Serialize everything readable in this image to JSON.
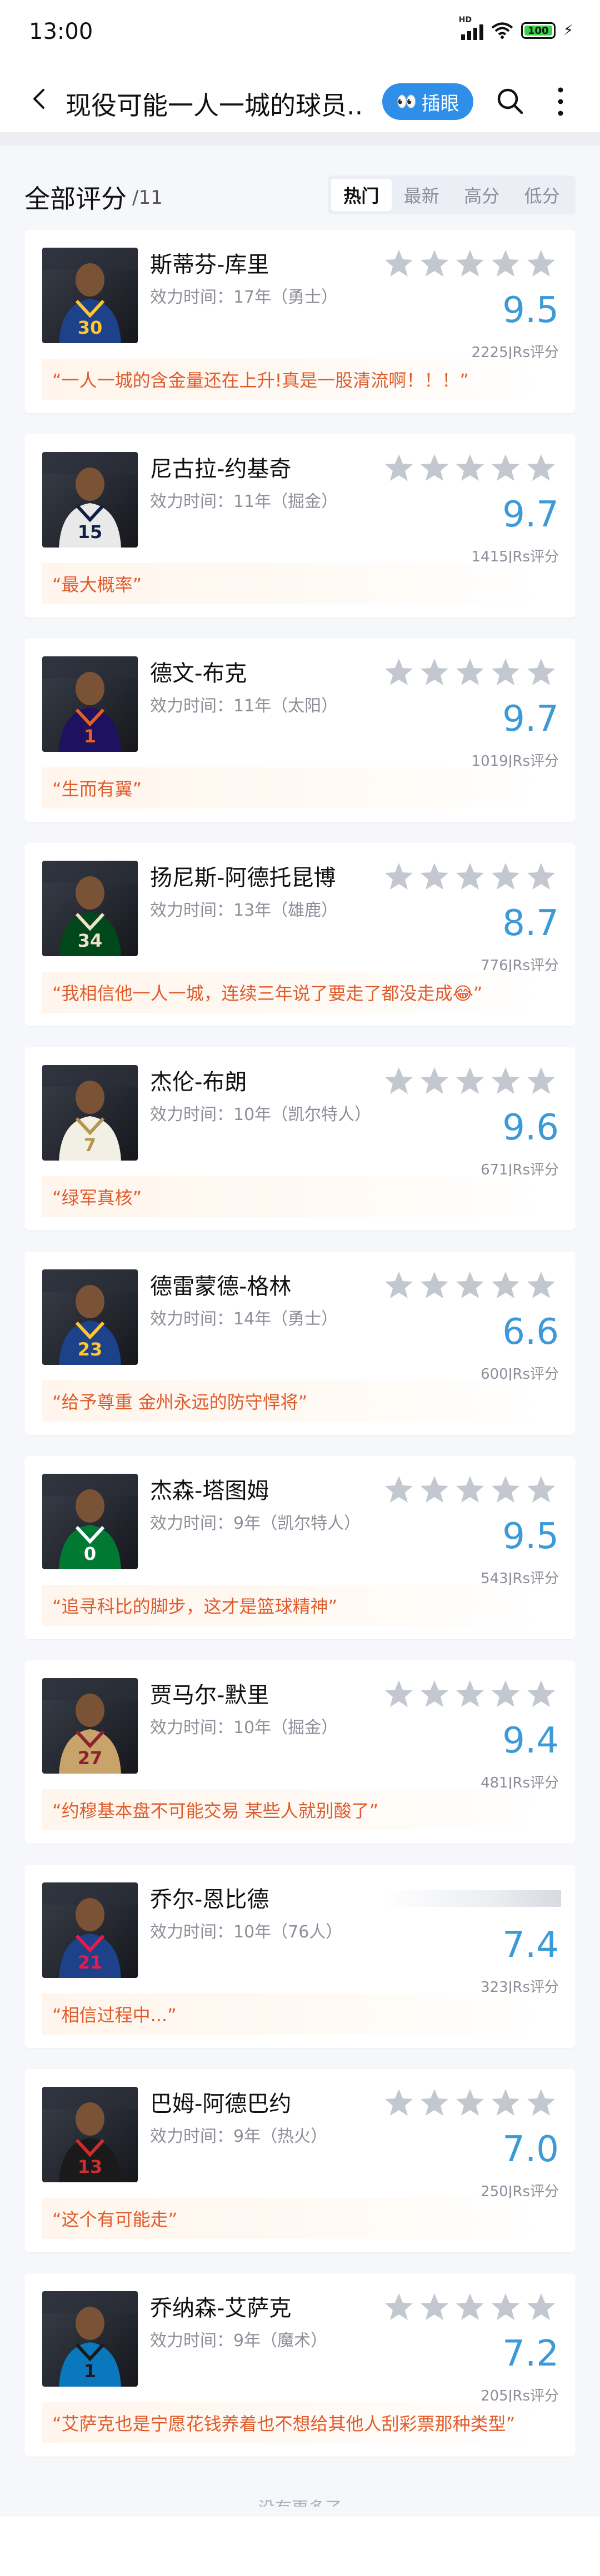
{
  "status_bar": {
    "time": "13:00",
    "battery": "100",
    "network": "HD"
  },
  "nav": {
    "title": "现役可能一人一城的球员..",
    "eyes_button_icon": "👀",
    "eyes_button_label": "插眼",
    "back_icon": "chevron-left-icon",
    "search_icon": "search-icon",
    "more_icon": "more-vertical-icon"
  },
  "section": {
    "title": "全部评分",
    "count": "/11"
  },
  "sort_tabs": [
    "热门",
    "最新",
    "高分",
    "低分"
  ],
  "colors": {
    "accent": "#3c9ad8",
    "quote_text": "#e05b2c",
    "eyes_button": "#2f8fe8",
    "star_empty": "#c3c7d0"
  },
  "players": [
    {
      "name": "斯蒂芬-库里",
      "tenure": "效力时间：17年（勇士）",
      "score": "9.5",
      "votes": "2225JRs评分",
      "quote": "“一人一城的含金量还在上升!真是一股清流啊！！！”",
      "jersey_color": "#1d428a",
      "accent_color": "#ffc72c",
      "number": "30"
    },
    {
      "name": "尼古拉-约基奇",
      "tenure": "效力时间：11年（掘金）",
      "score": "9.7",
      "votes": "1415JRs评分",
      "quote": "“最大概率”",
      "jersey_color": "#e9e9ea",
      "accent_color": "#0e2240",
      "number": "15"
    },
    {
      "name": "德文-布克",
      "tenure": "效力时间：11年（太阳）",
      "score": "9.7",
      "votes": "1019JRs评分",
      "quote": "“生而有翼”",
      "jersey_color": "#1d1160",
      "accent_color": "#e56020",
      "number": "1"
    },
    {
      "name": "扬尼斯-阿德托昆博",
      "tenure": "效力时间：13年（雄鹿）",
      "score": "8.7",
      "votes": "776JRs评分",
      "quote": "“我相信他一人一城，连续三年说了要走了都没走成😂”",
      "jersey_color": "#00471b",
      "accent_color": "#eee1c6",
      "number": "34"
    },
    {
      "name": "杰伦-布朗",
      "tenure": "效力时间：10年（凯尔特人）",
      "score": "9.6",
      "votes": "671JRs评分",
      "quote": "“绿军真核”",
      "jersey_color": "#f2efe4",
      "accent_color": "#b5954d",
      "number": "7"
    },
    {
      "name": "德雷蒙德-格林",
      "tenure": "效力时间：14年（勇士）",
      "score": "6.6",
      "votes": "600JRs评分",
      "quote": "“给予尊重 金州永远的防守悍将”",
      "jersey_color": "#1d428a",
      "accent_color": "#ffc72c",
      "number": "23"
    },
    {
      "name": "杰森-塔图姆",
      "tenure": "效力时间：9年（凯尔特人）",
      "score": "9.5",
      "votes": "543JRs评分",
      "quote": "“追寻科比的脚步，这才是篮球精神”",
      "jersey_color": "#007a33",
      "accent_color": "#ffffff",
      "number": "0"
    },
    {
      "name": "贾马尔-默里",
      "tenure": "效力时间：10年（掘金）",
      "score": "9.4",
      "votes": "481JRs评分",
      "quote": "“约穆基本盘不可能交易 某些人就别酸了”",
      "jersey_color": "#c8a36a",
      "accent_color": "#8b2131",
      "number": "27"
    },
    {
      "name": "乔尔-恩比德",
      "tenure": "效力时间：10年（76人）",
      "score": "7.4",
      "votes": "323JRs评分",
      "quote": "“相信过程中...”",
      "jersey_color": "#1d428a",
      "accent_color": "#ed174c",
      "number": "21"
    },
    {
      "name": "巴姆-阿德巴约",
      "tenure": "效力时间：9年（热火）",
      "score": "7.0",
      "votes": "250JRs评分",
      "quote": "“这个有可能走”",
      "jersey_color": "#1a1a1a",
      "accent_color": "#d12a2f",
      "number": "13"
    },
    {
      "name": "乔纳森-艾萨克",
      "tenure": "效力时间：9年（魔术）",
      "score": "7.2",
      "votes": "205JRs评分",
      "quote": "“艾萨克也是宁愿花钱养着也不想给其他人刮彩票那种类型”",
      "jersey_color": "#0b77bd",
      "accent_color": "#1a1a1a",
      "number": "1"
    }
  ],
  "footer": "没有更多了"
}
